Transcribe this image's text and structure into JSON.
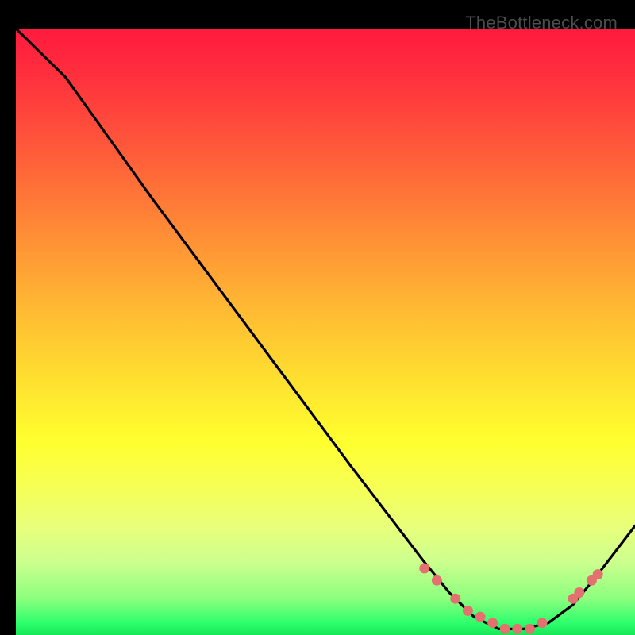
{
  "watermark": "TheBottleneck.com",
  "colors": {
    "line": "#000000",
    "marker": "#e47070",
    "background_black": "#000000"
  },
  "chart_data": {
    "type": "line",
    "title": "",
    "xlabel": "",
    "ylabel": "",
    "xlim": [
      0,
      100
    ],
    "ylim": [
      0,
      100
    ],
    "grid": false,
    "series": [
      {
        "name": "curve",
        "x": [
          0,
          8,
          15,
          22,
          30,
          38,
          46,
          54,
          60,
          66,
          70,
          74,
          78,
          82,
          86,
          90,
          94,
          100
        ],
        "y": [
          100,
          92,
          82,
          72,
          61,
          50,
          39,
          28,
          20,
          12,
          7,
          3,
          1,
          1,
          2,
          5,
          10,
          18
        ],
        "markers_x": [
          66,
          68,
          71,
          73,
          75,
          77,
          79,
          81,
          83,
          85,
          90,
          91,
          93,
          94
        ],
        "markers_y": [
          11,
          9,
          6,
          4,
          3,
          2,
          1,
          1,
          1,
          2,
          6,
          7,
          9,
          10
        ]
      }
    ]
  }
}
